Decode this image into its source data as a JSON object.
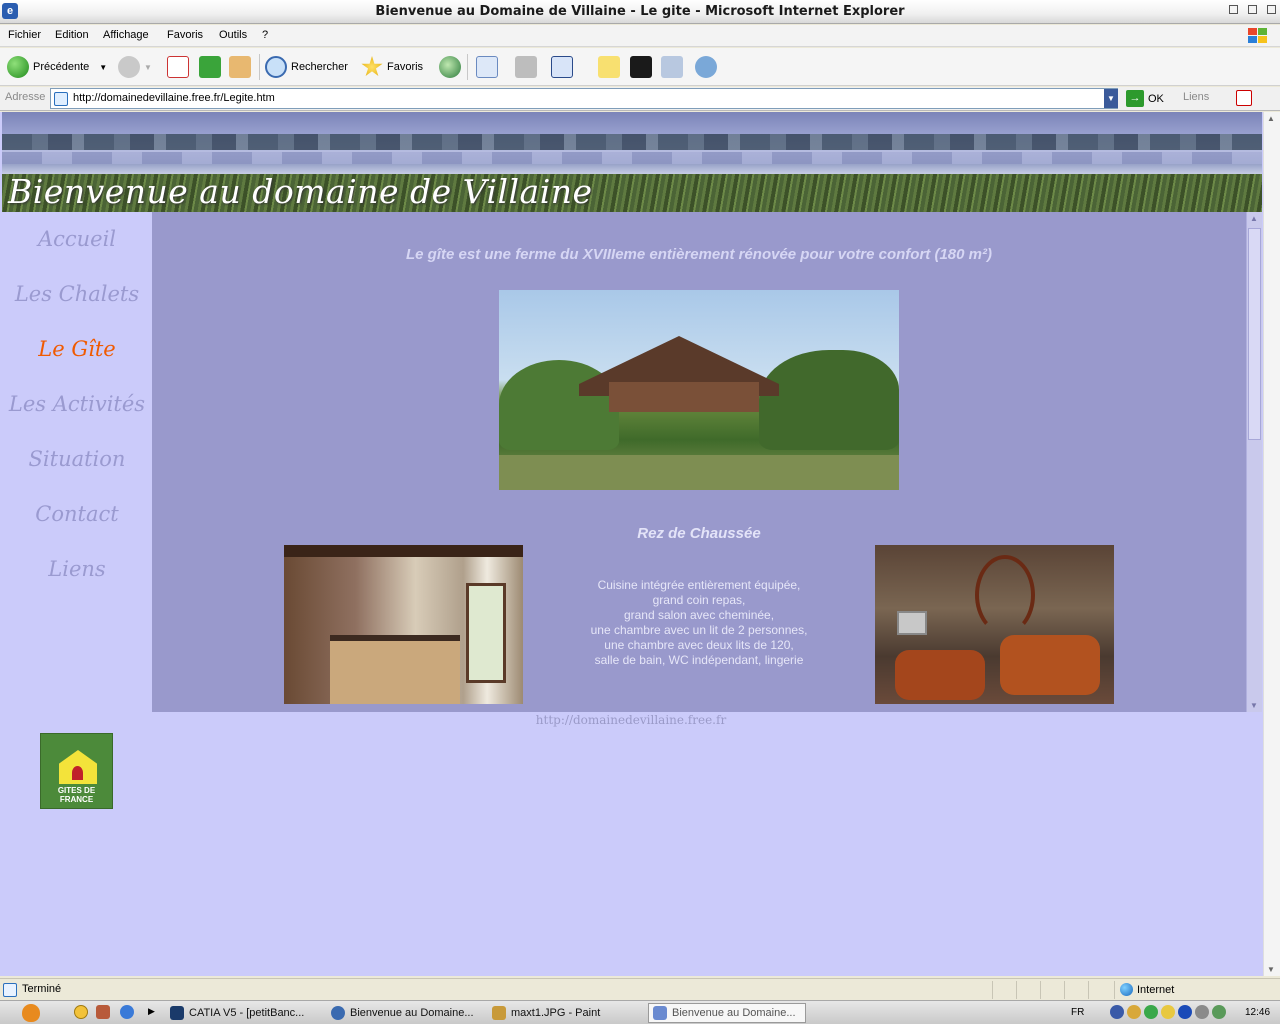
{
  "window": {
    "title": "Bienvenue au Domaine de Villaine - Le gite - Microsoft Internet Explorer"
  },
  "menu": [
    "Fichier",
    "Edition",
    "Affichage",
    "Favoris",
    "Outils",
    "?"
  ],
  "toolbar": {
    "back_label": "Précédente",
    "search_label": "Rechercher",
    "favorites_label": "Favoris"
  },
  "address": {
    "label": "Adresse",
    "url": "http://domainedevillaine.free.fr/Legite.htm",
    "go_label": "OK",
    "links_label": "Liens"
  },
  "page": {
    "banner_title": "Bienvenue au domaine de Villaine",
    "nav": [
      {
        "label": "Accueil",
        "active": false
      },
      {
        "label": "Les Chalets",
        "active": false
      },
      {
        "label": "Le Gîte",
        "active": true
      },
      {
        "label": "Les Activités",
        "active": false
      },
      {
        "label": "Situation",
        "active": false
      },
      {
        "label": "Contact",
        "active": false
      },
      {
        "label": "Liens",
        "active": false
      }
    ],
    "logo_text": "GITES DE FRANCE",
    "intro": "Le gîte est une ferme du XVIIIeme entièrement rénovée pour votre confort (180 m²)",
    "section_title": "Rez de Chaussée",
    "description_lines": [
      "Cuisine intégrée entièrement équipée,",
      "grand coin repas,",
      "grand salon avec cheminée,",
      "une chambre avec un lit de 2 personnes,",
      "une chambre avec deux lits de 120,",
      "salle de bain, WC indépendant, lingerie"
    ],
    "footer_url": "http://domainedevillaine.free.fr"
  },
  "status": {
    "text": "Terminé",
    "zone": "Internet"
  },
  "taskbar": {
    "items": [
      {
        "label": "CATIA V5 - [petitBanc...",
        "active": false
      },
      {
        "label": "Bienvenue au Domaine...",
        "active": false
      },
      {
        "label": "maxt1.JPG - Paint",
        "active": false
      },
      {
        "label": "Bienvenue au Domaine...",
        "active": true
      }
    ],
    "language": "FR",
    "clock": "12:46"
  },
  "colors": {
    "page_background": "#cbcbfa",
    "content_background": "#9999cc",
    "nav_text": "#9a9ad0",
    "nav_active": "#f05a00"
  }
}
